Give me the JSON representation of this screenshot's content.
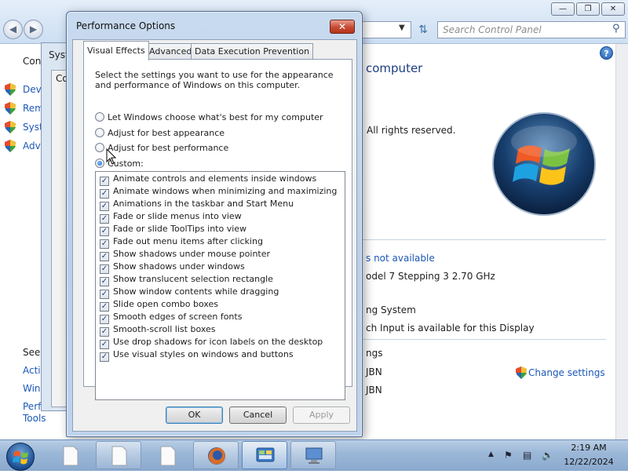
{
  "control_panel": {
    "search_placeholder": "Search Control Panel",
    "help_symbol": "?",
    "left_title": "Con",
    "left_items": [
      "Devi",
      "Rem",
      "Syst",
      "Adv"
    ],
    "see_also": "See",
    "see_also_items": [
      "Acti",
      "Win",
      "Perf",
      "Tools"
    ],
    "heading": "computer",
    "copyright": "All rights reserved.",
    "not_available": "s not available",
    "processor": "odel 7 Stepping 3   2.70 GHz",
    "system_type": "ng System",
    "pen_touch": "ch Input is available for this Display",
    "settings_label": "ngs",
    "computer_name_1": "JBN",
    "computer_name_2": "JBN",
    "change_settings": "Change settings"
  },
  "system_properties": {
    "title": "Syst",
    "tab": "Co"
  },
  "dialog": {
    "title": "Performance Options",
    "close_symbol": "✕",
    "tabs": [
      "Visual Effects",
      "Advanced",
      "Data Execution Prevention"
    ],
    "description": "Select the settings you want to use for the appearance and performance of Windows on this computer.",
    "radios": [
      {
        "label": "Let Windows choose what's best for my computer",
        "selected": false
      },
      {
        "label": "Adjust for best appearance",
        "selected": false
      },
      {
        "label": "Adjust for best performance",
        "selected": false
      },
      {
        "label": "Custom:",
        "selected": true
      }
    ],
    "effects": [
      "Animate controls and elements inside windows",
      "Animate windows when minimizing and maximizing",
      "Animations in the taskbar and Start Menu",
      "Fade or slide menus into view",
      "Fade or slide ToolTips into view",
      "Fade out menu items after clicking",
      "Show shadows under mouse pointer",
      "Show shadows under windows",
      "Show translucent selection rectangle",
      "Show window contents while dragging",
      "Slide open combo boxes",
      "Smooth edges of screen fonts",
      "Smooth-scroll list boxes",
      "Use drop shadows for icon labels on the desktop",
      "Use visual styles on windows and buttons"
    ],
    "buttons": {
      "ok": "OK",
      "cancel": "Cancel",
      "apply": "Apply"
    }
  },
  "taskbar": {
    "time": "2:19 AM",
    "date": "12/22/2024"
  }
}
